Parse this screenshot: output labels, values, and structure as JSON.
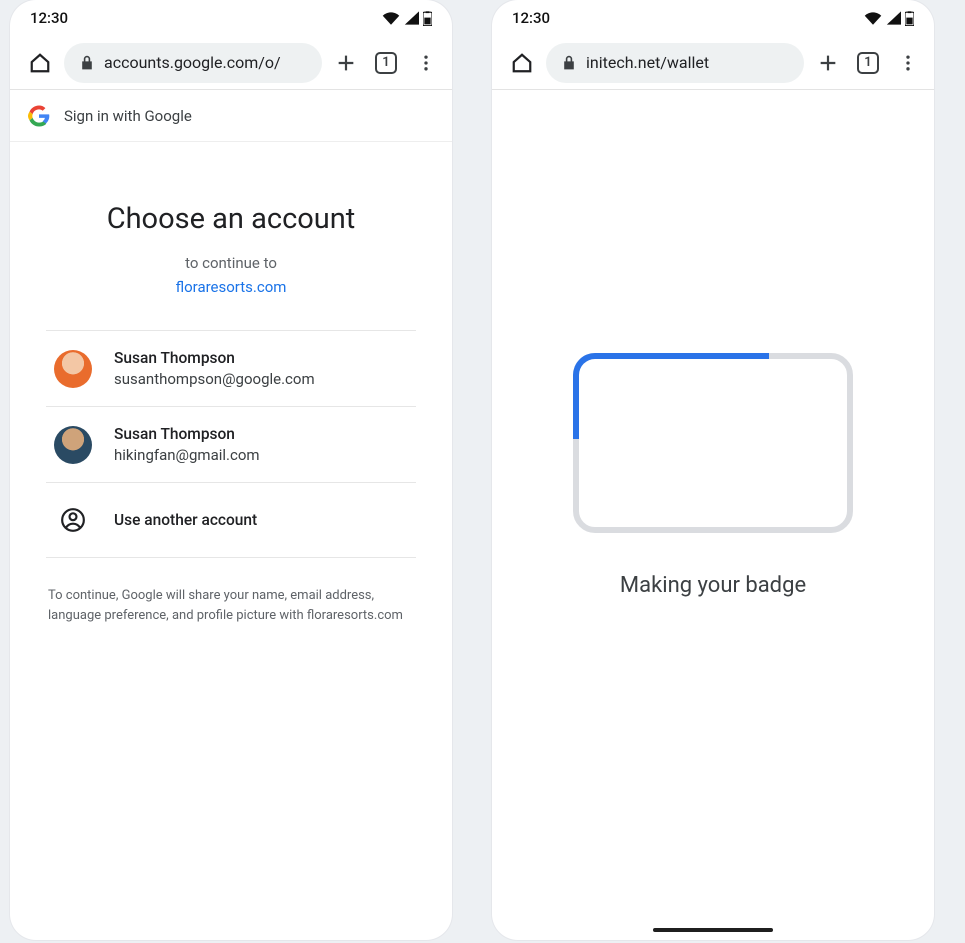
{
  "status": {
    "time": "12:30"
  },
  "toolbar": {
    "tab_count": "1"
  },
  "screen1": {
    "url": "accounts.google.com/o/",
    "header_label": "Sign in with Google",
    "title": "Choose an account",
    "subtitle": "to continue to",
    "rp_domain": "floraresorts.com",
    "accounts": [
      {
        "name": "Susan Thompson",
        "email": "susanthompson@google.com"
      },
      {
        "name": "Susan Thompson",
        "email": "hikingfan@gmail.com"
      }
    ],
    "use_another_label": "Use another account",
    "footnote": "To continue, Google will share your name, email address, language preference, and profile picture with floraresorts.com"
  },
  "screen2": {
    "url": "initech.net/wallet",
    "status_text": "Making your badge"
  }
}
